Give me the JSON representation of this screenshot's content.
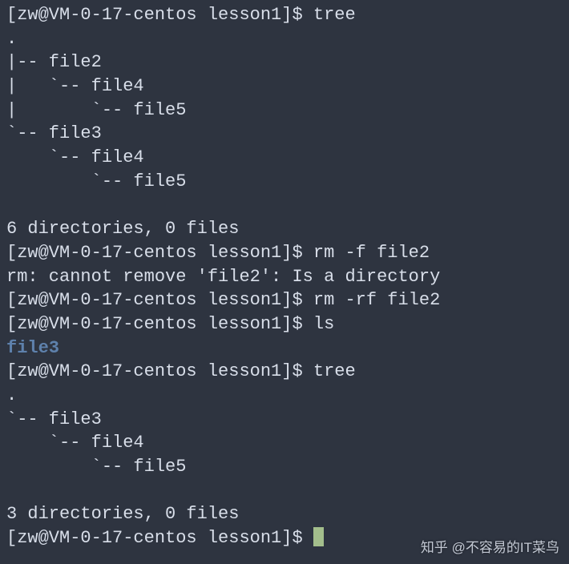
{
  "terminal": {
    "prompt": "[zw@VM-0-17-centos lesson1]$ ",
    "lines": [
      {
        "text": "[zw@VM-0-17-centos lesson1]$ tree",
        "type": "cmd"
      },
      {
        "text": ".",
        "type": "out"
      },
      {
        "text": "|-- file2",
        "type": "out"
      },
      {
        "text": "|   `-- file4",
        "type": "out"
      },
      {
        "text": "|       `-- file5",
        "type": "out"
      },
      {
        "text": "`-- file3",
        "type": "out"
      },
      {
        "text": "    `-- file4",
        "type": "out"
      },
      {
        "text": "        `-- file5",
        "type": "out"
      },
      {
        "text": "",
        "type": "out"
      },
      {
        "text": "6 directories, 0 files",
        "type": "out"
      },
      {
        "text": "[zw@VM-0-17-centos lesson1]$ rm -f file2",
        "type": "cmd"
      },
      {
        "text": "rm: cannot remove 'file2': Is a directory",
        "type": "out"
      },
      {
        "text": "[zw@VM-0-17-centos lesson1]$ rm -rf file2",
        "type": "cmd"
      },
      {
        "text": "[zw@VM-0-17-centos lesson1]$ ls",
        "type": "cmd"
      },
      {
        "text": "file3",
        "type": "dir"
      },
      {
        "text": "[zw@VM-0-17-centos lesson1]$ tree",
        "type": "cmd"
      },
      {
        "text": ".",
        "type": "out"
      },
      {
        "text": "`-- file3",
        "type": "out"
      },
      {
        "text": "    `-- file4",
        "type": "out"
      },
      {
        "text": "        `-- file5",
        "type": "out"
      },
      {
        "text": "",
        "type": "out"
      },
      {
        "text": "3 directories, 0 files",
        "type": "out"
      },
      {
        "text": "[zw@VM-0-17-centos lesson1]$ ",
        "type": "prompt-cursor"
      }
    ]
  },
  "watermark": {
    "platform": "知乎",
    "author": "@不容易的IT菜鸟"
  },
  "colors": {
    "background": "#2e3440",
    "foreground": "#d8dee9",
    "directory": "#5e81ac",
    "cursor": "#a3be8c"
  }
}
